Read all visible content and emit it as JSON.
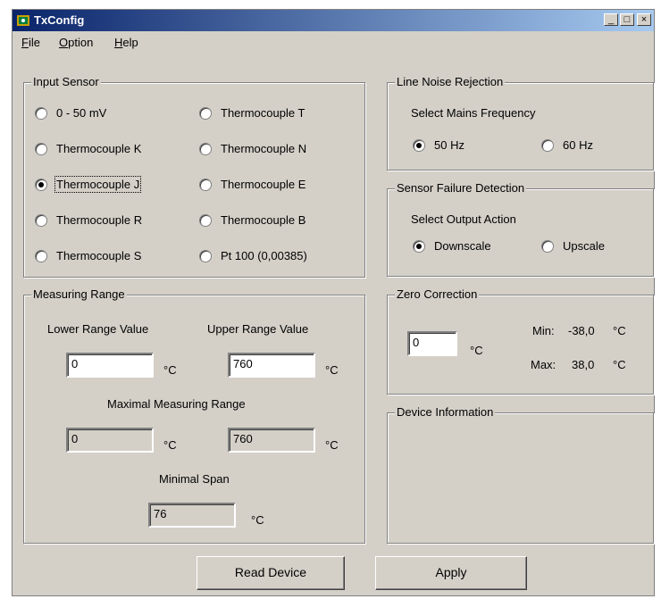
{
  "window": {
    "title": "TxConfig"
  },
  "menu": {
    "file": "File",
    "option": "Option",
    "help": "Help"
  },
  "input_sensor": {
    "label": "Input Sensor",
    "options": [
      "0 - 50 mV",
      "Thermocouple T",
      "Thermocouple K",
      "Thermocouple N",
      "Thermocouple J",
      "Thermocouple E",
      "Thermocouple R",
      "Thermocouple B",
      "Thermocouple S",
      "Pt 100 (0,00385)"
    ],
    "selected": "Thermocouple J"
  },
  "line_noise": {
    "label": "Line Noise Rejection",
    "caption": "Select Mains Frequency",
    "opt_50": "50 Hz",
    "opt_60": "60 Hz",
    "selected": "50 Hz"
  },
  "sensor_failure": {
    "label": "Sensor Failure Detection",
    "caption": "Select Output Action",
    "opt_down": "Downscale",
    "opt_up": "Upscale",
    "selected": "Downscale"
  },
  "measuring_range": {
    "label": "Measuring Range",
    "lower_label": "Lower Range Value",
    "upper_label": "Upper Range Value",
    "lower_value": "0",
    "upper_value": "760",
    "maximal_label": "Maximal Measuring Range",
    "max_lower": "0",
    "max_upper": "760",
    "minimal_label": "Minimal Span",
    "min_span": "76",
    "unit": "°C"
  },
  "zero_correction": {
    "label": "Zero Correction",
    "value": "0",
    "unit": "°C",
    "min_label": "Min:",
    "min_value": "-38,0",
    "max_label": "Max:",
    "max_value": "38,0"
  },
  "device_info": {
    "label": "Device Information"
  },
  "buttons": {
    "read": "Read Device",
    "apply": "Apply"
  }
}
